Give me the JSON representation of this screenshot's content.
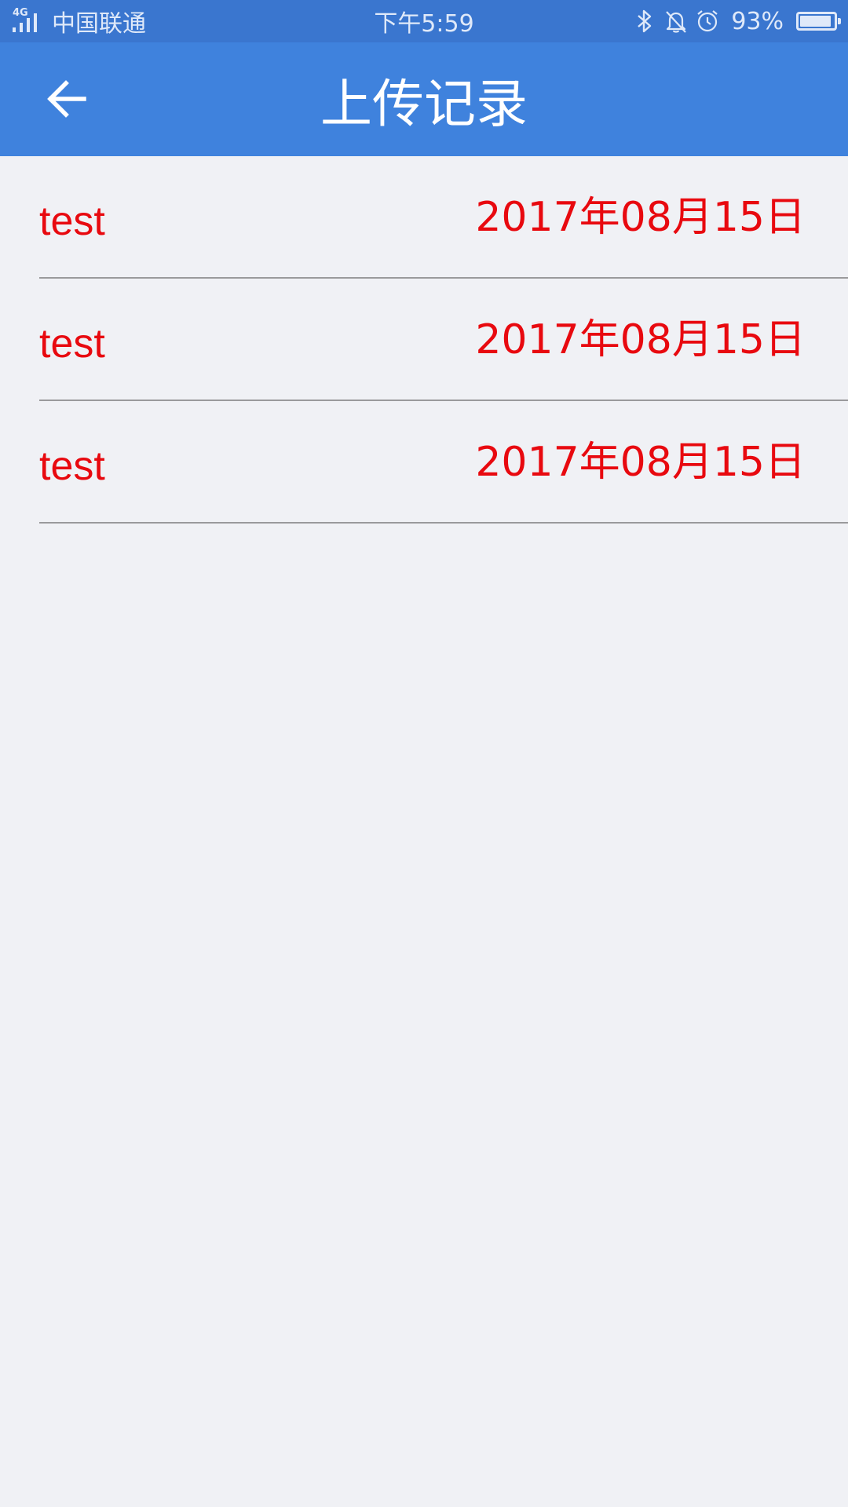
{
  "status_bar": {
    "network": "4G",
    "carrier": "中国联通",
    "time": "下午5:59",
    "battery_percent": "93%",
    "battery_level": 0.93,
    "icons": [
      "bluetooth-icon",
      "bell-off-icon",
      "alarm-icon"
    ]
  },
  "header": {
    "title": "上传记录",
    "back_icon": "arrow-left-icon",
    "background": "#3f82dd"
  },
  "records": [
    {
      "name": "test",
      "date": "2017年08月15日"
    },
    {
      "name": "test",
      "date": "2017年08月15日"
    },
    {
      "name": "test",
      "date": "2017年08月15日"
    }
  ],
  "colors": {
    "status_bar": "#3a76cf",
    "record_text": "#e8090f",
    "page_background": "#f0f1f5"
  }
}
